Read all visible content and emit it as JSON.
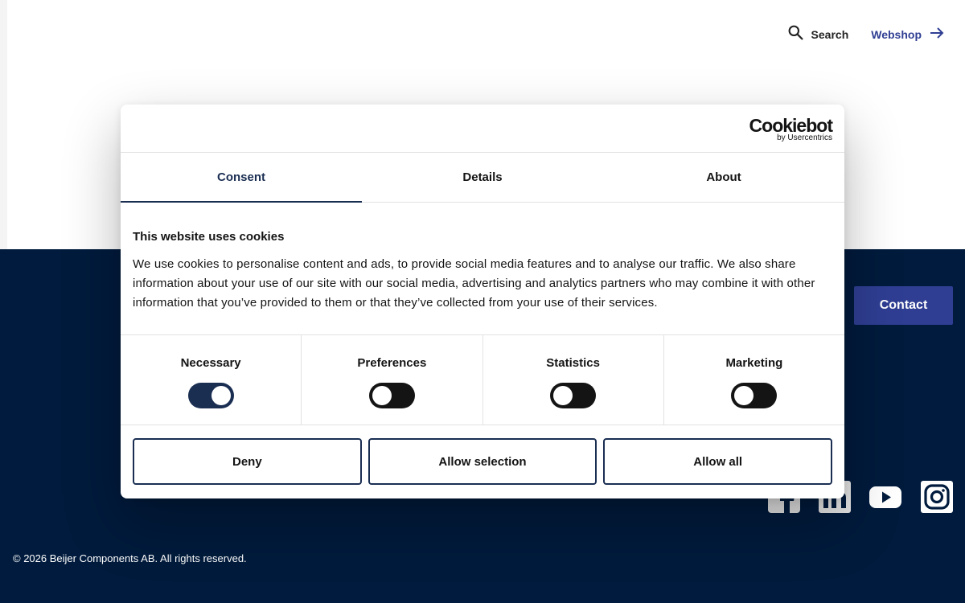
{
  "nav": {
    "search_label": "Search",
    "webshop_label": "Webshop"
  },
  "footer": {
    "contact_label": "Contact",
    "copyright": "© 2026 Beijer Components AB. All rights reserved.",
    "socials": [
      "facebook-icon",
      "linkedin-icon",
      "youtube-icon",
      "instagram-icon"
    ]
  },
  "dialog": {
    "brand": {
      "name": "Cookiebot",
      "byline": "by Usercentrics"
    },
    "tabs": [
      {
        "label": "Consent",
        "active": true
      },
      {
        "label": "Details",
        "active": false
      },
      {
        "label": "About",
        "active": false
      }
    ],
    "heading": "This website uses cookies",
    "body": "We use cookies to personalise content and ads, to provide social media features and to analyse our traffic. We also share information about your use of our site with our social media, advertising and analytics partners who may combine it with other information that you’ve provided to them or that they’ve collected from your use of their services.",
    "toggles": [
      {
        "label": "Necessary",
        "checked": true
      },
      {
        "label": "Preferences",
        "checked": false
      },
      {
        "label": "Statistics",
        "checked": false
      },
      {
        "label": "Marketing",
        "checked": false
      }
    ],
    "buttons": {
      "deny": "Deny",
      "allow_selection": "Allow selection",
      "allow_all": "Allow all"
    }
  },
  "colors": {
    "footer_bg": "#001b3d",
    "accent": "#2f3e93",
    "dialog_border": "#1a2e52"
  }
}
